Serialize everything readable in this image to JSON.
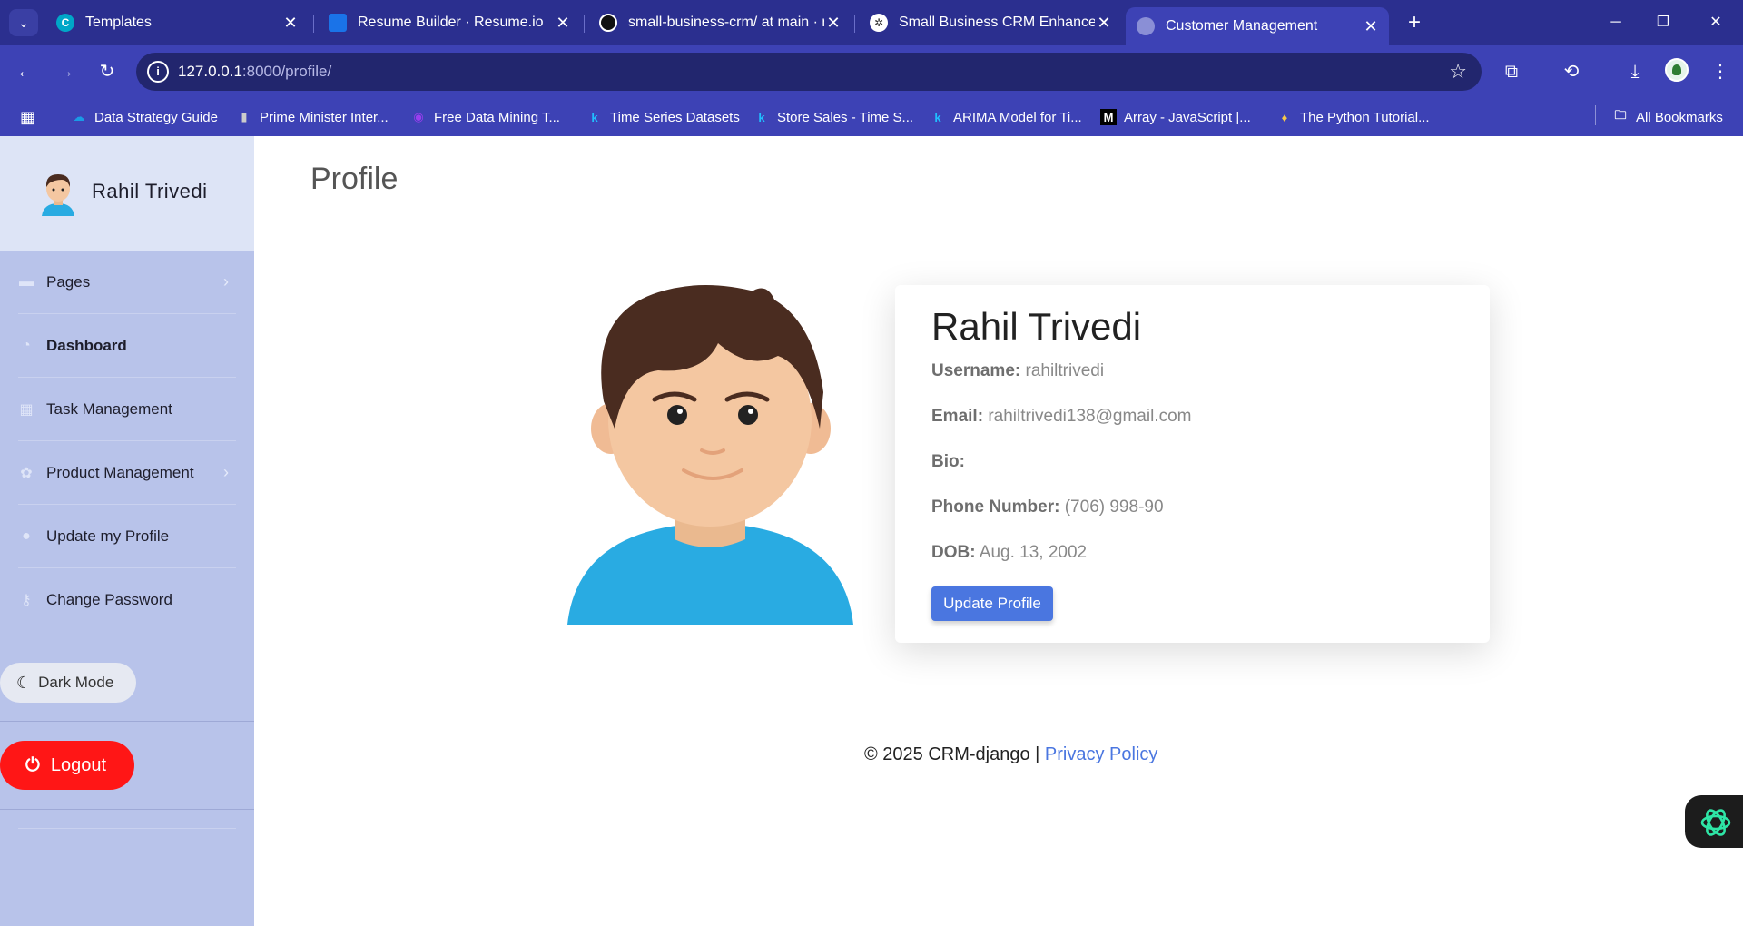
{
  "browser": {
    "tabs": [
      {
        "title": "Templates",
        "favicon_color": "#00a7c8",
        "favicon_glyph": "C"
      },
      {
        "title": "Resume Builder · Resume.io",
        "favicon_color": "#1a73e8",
        "favicon_glyph": "▪"
      },
      {
        "title": "small-business-crm/ at main · ra",
        "favicon_color": "#111111",
        "favicon_glyph": "●"
      },
      {
        "title": "Small Business CRM Enhancem",
        "favicon_color": "#444444",
        "favicon_glyph": "✲"
      },
      {
        "title": "Customer Management",
        "favicon_color": "#8a8fd6",
        "favicon_glyph": "◍"
      }
    ],
    "address": {
      "host": "127.0.0.1",
      "path": ":8000/profile/"
    },
    "bookmarks": [
      {
        "label": "Data Strategy Guide",
        "icon": "cloud-icon",
        "color": "#1a9be6",
        "glyph": "☁"
      },
      {
        "label": "Prime Minister Inter...",
        "icon": "bar-icon",
        "color": "#cccccc",
        "glyph": "▮"
      },
      {
        "label": "Free Data Mining T...",
        "icon": "shield-icon",
        "color": "#9b3ef0",
        "glyph": "◉"
      },
      {
        "label": "Time Series Datasets",
        "icon": "kaggle-icon",
        "color": "#20beff",
        "glyph": "k"
      },
      {
        "label": "Store Sales - Time S...",
        "icon": "kaggle-icon",
        "color": "#20beff",
        "glyph": "k"
      },
      {
        "label": "ARIMA Model for Ti...",
        "icon": "kaggle-icon",
        "color": "#20beff",
        "glyph": "k"
      },
      {
        "label": "Array - JavaScript |...",
        "icon": "mdn-icon",
        "color": "#000000",
        "glyph": "M"
      },
      {
        "label": "The Python Tutorial...",
        "icon": "python-icon",
        "color": "#f7c948",
        "glyph": "♦"
      }
    ],
    "all_bookmarks": "All Bookmarks"
  },
  "sidebar": {
    "user_name": "Rahil Trivedi",
    "items": [
      {
        "label": "Pages",
        "icon": "folder-icon",
        "glyph": "▬",
        "has_chevron": true,
        "bold": false
      },
      {
        "label": "Dashboard",
        "icon": "gauge-icon",
        "glyph": "◔",
        "has_chevron": false,
        "bold": true
      },
      {
        "label": "Task Management",
        "icon": "calendar-icon",
        "glyph": "▦",
        "has_chevron": false,
        "bold": false
      },
      {
        "label": "Product Management",
        "icon": "cogs-icon",
        "glyph": "✿",
        "has_chevron": true,
        "bold": false
      },
      {
        "label": "Update my Profile",
        "icon": "user-icon",
        "glyph": "●",
        "has_chevron": false,
        "bold": false
      },
      {
        "label": "Change Password",
        "icon": "key-icon",
        "glyph": "⚷",
        "has_chevron": false,
        "bold": false
      }
    ],
    "dark_mode_label": "Dark Mode",
    "logout_label": "Logout"
  },
  "main": {
    "page_title": "Profile",
    "profile": {
      "name": "Rahil Trivedi",
      "username_label": "Username:",
      "username": "rahiltrivedi",
      "email_label": "Email:",
      "email": "rahiltrivedi138@gmail.com",
      "bio_label": "Bio:",
      "bio": "",
      "phone_label": "Phone Number:",
      "phone": "(706) 998-90",
      "dob_label": "DOB:",
      "dob": "Aug. 13, 2002",
      "update_button": "Update Profile"
    },
    "footer": {
      "text": "© 2025 CRM-django | ",
      "link": "Privacy Policy"
    }
  },
  "colors": {
    "chrome_dark": "#2b2f8f",
    "chrome": "#3d42b5",
    "sidebar": "#b8c3ea",
    "sidebar_header": "#dde4f6",
    "logout": "#ff1616",
    "primary": "#4a76e0"
  }
}
